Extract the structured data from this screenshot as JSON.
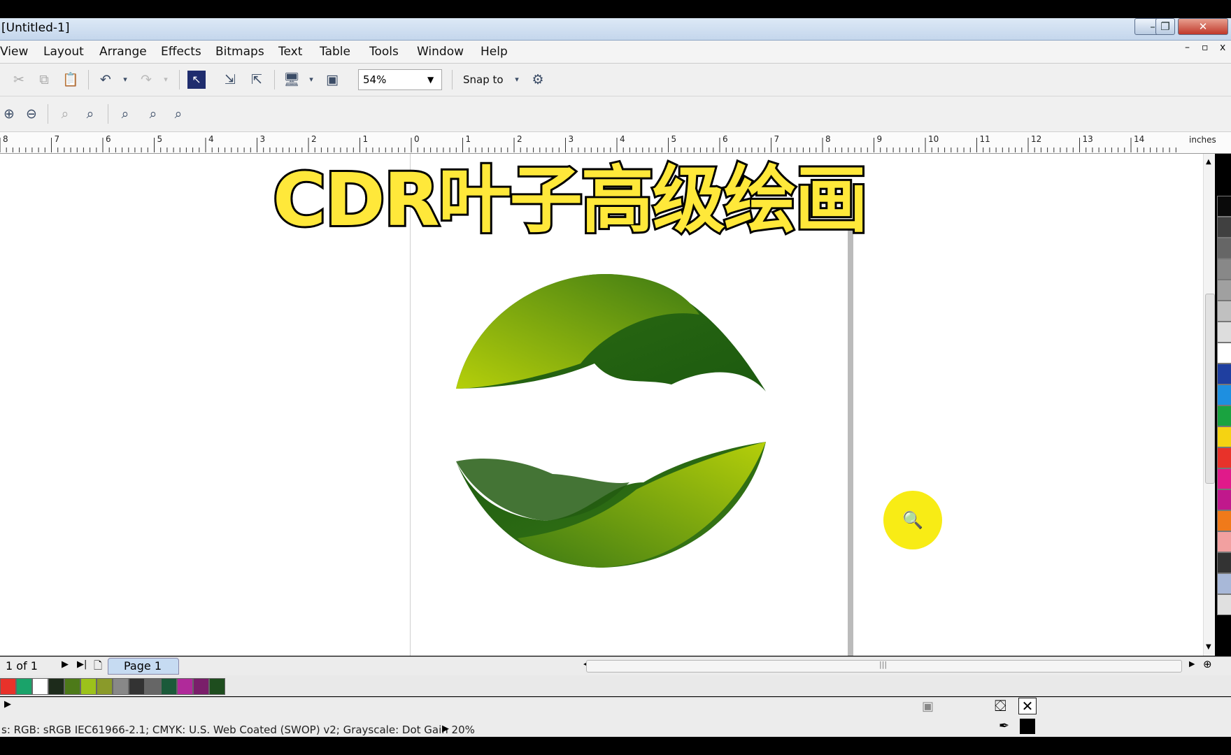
{
  "window": {
    "title": "[Untitled-1]",
    "buttons": [
      "–",
      "❐",
      "✕"
    ]
  },
  "menu": [
    "View",
    "Layout",
    "Arrange",
    "Effects",
    "Bitmaps",
    "Text",
    "Table",
    "Tools",
    "Window",
    "Help"
  ],
  "toolbar": {
    "zoom_value": "54%",
    "snap_to": "Snap to"
  },
  "ruler": {
    "ticks": [
      "8",
      "7",
      "6",
      "5",
      "4",
      "3",
      "2",
      "1",
      "0",
      "1",
      "2",
      "3",
      "4",
      "5",
      "6",
      "7",
      "8",
      "9",
      "10",
      "11",
      "12",
      "13",
      "14"
    ],
    "unit": "inches"
  },
  "overlay": {
    "headline": "CDR叶子高级绘画"
  },
  "page_nav": {
    "count": "1 of 1",
    "tab": "Page 1"
  },
  "status": {
    "color_profile": "s: RGB: sRGB IEC61966-2.1; CMYK: U.S. Web Coated (SWOP) v2; Grayscale: Dot Gain 20%"
  },
  "colors": {
    "swatches": [
      "#e8322a",
      "#1aa36a",
      "#ffffff",
      "#1d2b1b",
      "#4d7a19",
      "#9cc21b",
      "#8a9a2a",
      "#888888",
      "#333333",
      "#666666",
      "#1b5a3a",
      "#b02a9a",
      "#7a1e6a",
      "#1e4d1e"
    ],
    "palette": [
      "#0a0a0a",
      "#404040",
      "#666666",
      "#888888",
      "#a0a0a0",
      "#c0c0c0",
      "#dddddd",
      "#ffffff",
      "#1f3fa0",
      "#1e8fe0",
      "#1aa340",
      "#f5d312",
      "#e8322a",
      "#e01a8a",
      "#c0188c",
      "#f07a1a",
      "#f2a0a0",
      "#333333",
      "#a8b8d8",
      "#e0e0e0"
    ],
    "leaf_light": "#b5cf0a",
    "leaf_dark": "#1c5a10"
  }
}
